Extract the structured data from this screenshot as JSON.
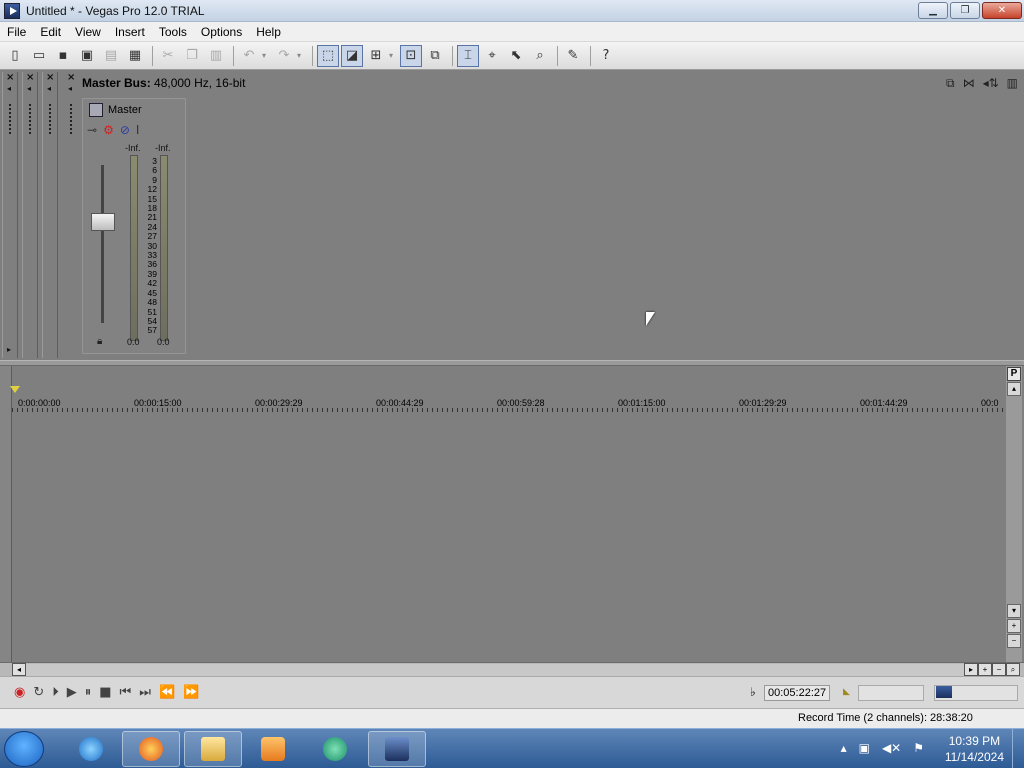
{
  "window": {
    "title": "Untitled * - Vegas Pro 12.0 TRIAL",
    "min": "▁",
    "max": "❐",
    "close": "✕"
  },
  "menu": [
    "File",
    "Edit",
    "View",
    "Insert",
    "Tools",
    "Options",
    "Help"
  ],
  "mixer": {
    "bus_label": "Master Bus:",
    "bus_format": "48,000 Hz, 16-bit",
    "master_label": "Master",
    "meter_left_peak": "-Inf.",
    "meter_right_peak": "-Inf.",
    "scale": [
      "3",
      "6",
      "9",
      "12",
      "15",
      "18",
      "21",
      "24",
      "27",
      "30",
      "33",
      "36",
      "39",
      "42",
      "45",
      "48",
      "51",
      "54",
      "57"
    ],
    "meter_left_value": "0.0",
    "meter_right_value": "0.0"
  },
  "timeline": {
    "timecodes": [
      "0:00:00:00",
      "00:00:15:00",
      "00:00:29:29",
      "00:00:44:29",
      "00:00:59:28",
      "00:01:15:00",
      "00:01:29:29",
      "00:01:44:29",
      "00:0"
    ]
  },
  "transport": {
    "timecode": "00:05:22:27"
  },
  "status": {
    "record_time": "Record Time (2 channels): 28:38:20"
  },
  "taskbar": {
    "time": "10:39 PM",
    "date": "11/14/2024"
  }
}
